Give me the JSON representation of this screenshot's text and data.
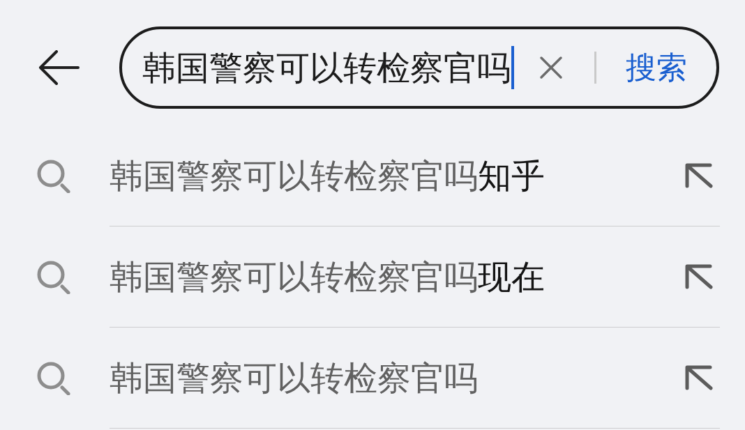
{
  "search_bar": {
    "value": "韩国警察可以转检察官吗",
    "focused": true,
    "search_button": "搜索"
  },
  "suggestions": [
    {
      "query_part": "韩国警察可以转检察官吗",
      "completion": "知乎"
    },
    {
      "query_part": "韩国警察可以转检察官吗",
      "completion": "现在"
    },
    {
      "query_part": "韩国警察可以转检察官吗"
    }
  ]
}
